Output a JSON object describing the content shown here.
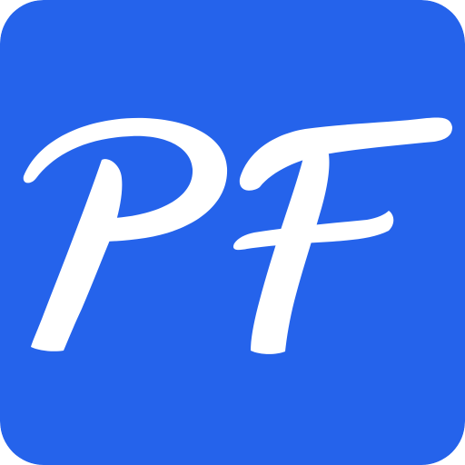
{
  "app_icon": {
    "monogram": "PF",
    "icon_name": "pf-monogram-logo-icon",
    "colors": {
      "background": "#2563EB",
      "glyph": "#FFFFFF"
    }
  }
}
